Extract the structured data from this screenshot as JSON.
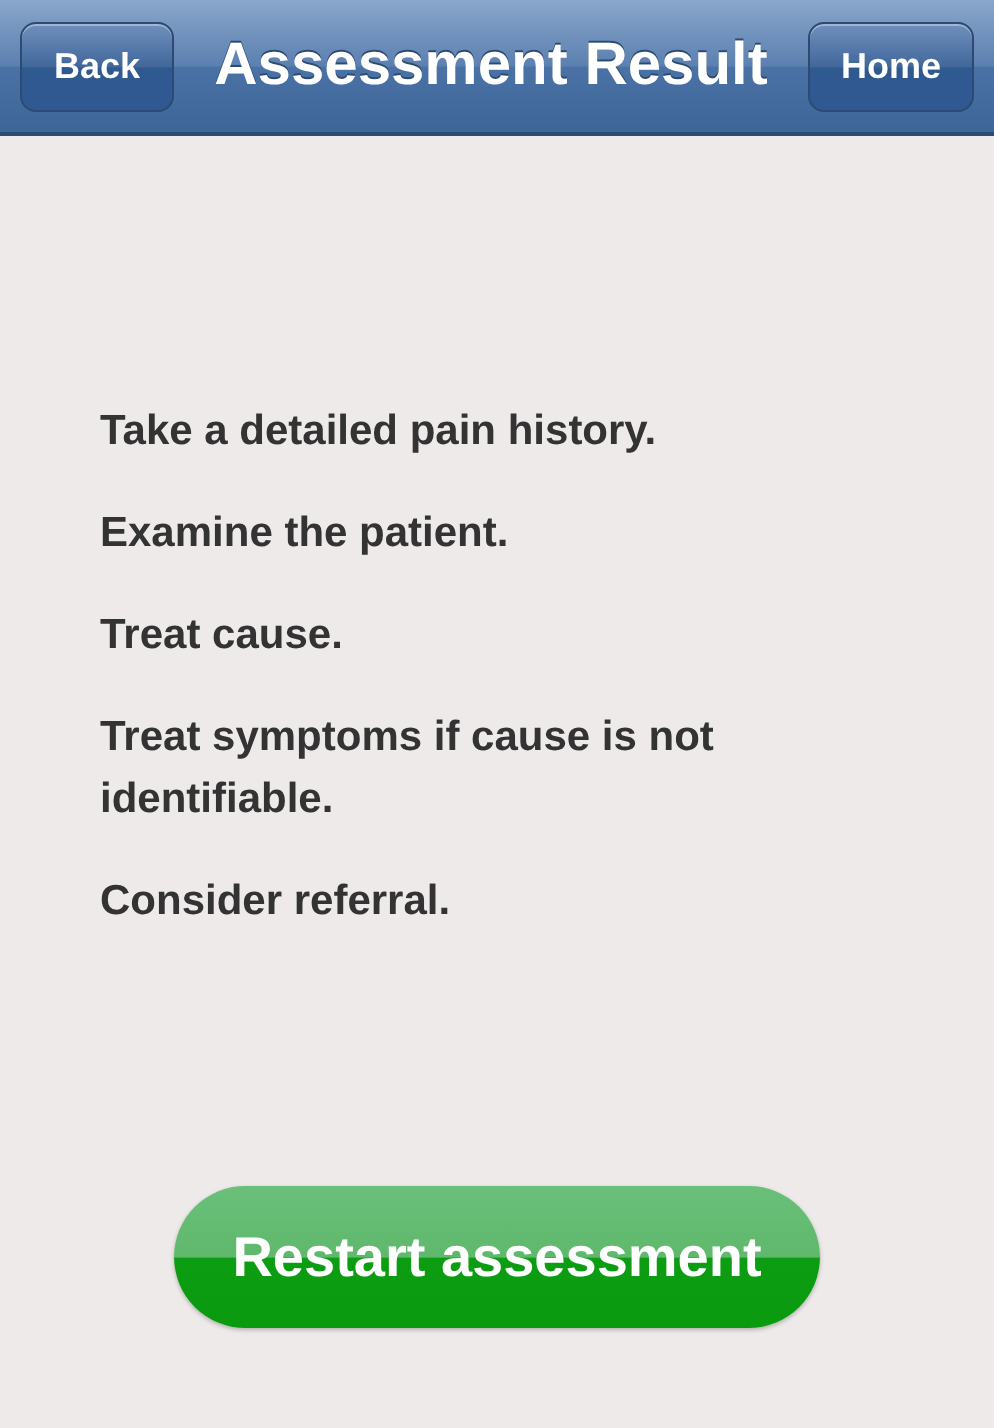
{
  "nav_bar": {
    "back_button": "Back",
    "title": "Assessment Result",
    "home_button": "Home"
  },
  "instructions": [
    "Take a detailed pain history.",
    "Examine the patient.",
    "Treat cause.",
    "Treat symptoms if cause is not identifiable.",
    "Consider referral."
  ],
  "restart_button": "Restart assessment"
}
